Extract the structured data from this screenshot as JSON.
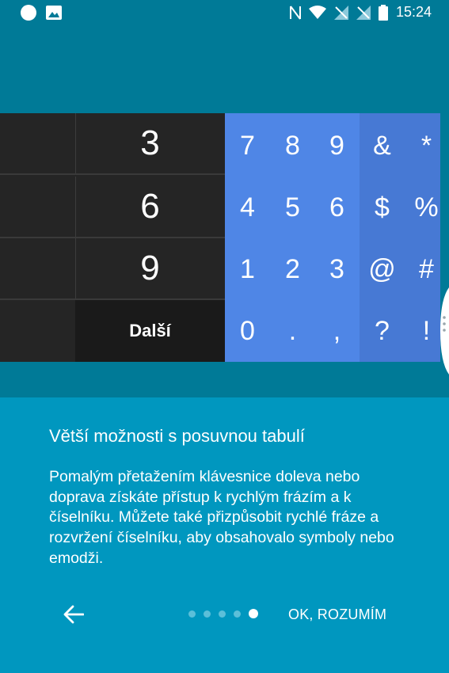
{
  "status_bar": {
    "time": "15:24",
    "left_icons": [
      "circle-notification-icon",
      "image-notification-icon"
    ],
    "right_icons": [
      "nfc-icon",
      "wifi-icon",
      "no-signal-icon",
      "no-signal-icon",
      "battery-icon"
    ]
  },
  "keyboard": {
    "dark_keys": [
      "3",
      "6",
      "9"
    ],
    "next_label": "Další",
    "blue_keys": [
      [
        "7",
        "8",
        "9",
        "&",
        "*"
      ],
      [
        "4",
        "5",
        "6",
        "$",
        "%"
      ],
      [
        "1",
        "2",
        "3",
        "@",
        "#"
      ],
      [
        "0",
        ".",
        ",",
        "?",
        "!"
      ]
    ]
  },
  "content": {
    "title": "Větší možnosti s posuvnou tabulí",
    "body": "Pomalým přetažením klávesnice doleva nebo doprava získáte přístup k rychlým frázím a k číselníku. Můžete také přizpůsobit rychlé fráze a rozvržení číselníku, aby obsahovalo symboly nebo emodži."
  },
  "footer": {
    "ok_label": "OK, ROZUMÍM",
    "page_count": 5,
    "active_page": 5
  },
  "colors": {
    "background": "#0097bf",
    "top_panel": "#007a97",
    "dark_keys": "#252525",
    "blue_keys": "#4f86e6"
  }
}
